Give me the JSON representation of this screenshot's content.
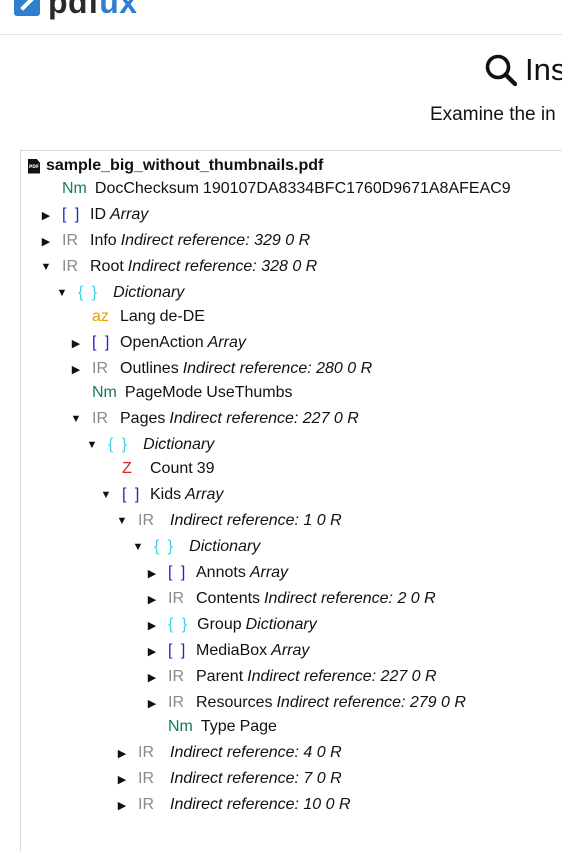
{
  "header": {
    "logo_prefix": "pdf",
    "logo_accent": "ux"
  },
  "page": {
    "title": "Ins",
    "subtitle": "Examine the in"
  },
  "tree": {
    "file_name": "sample_big_without_thumbnails.pdf",
    "rows": [
      {
        "tag": "Nm",
        "key": "DocChecksum",
        "value": "190107DA8334BFC1760D9671A8AFEAC9"
      },
      {
        "tag": "[ ]",
        "key": "ID",
        "value": "Array"
      },
      {
        "tag": "IR",
        "key": "Info",
        "value": "Indirect reference: 329 0 R"
      },
      {
        "tag": "IR",
        "key": "Root",
        "value": "Indirect reference: 328 0 R"
      },
      {
        "tag": "{ }",
        "key": "",
        "value": "Dictionary"
      },
      {
        "tag": "az",
        "key": "Lang",
        "value": "de-DE"
      },
      {
        "tag": "[ ]",
        "key": "OpenAction",
        "value": "Array"
      },
      {
        "tag": "IR",
        "key": "Outlines",
        "value": "Indirect reference: 280 0 R"
      },
      {
        "tag": "Nm",
        "key": "PageMode",
        "value": "UseThumbs"
      },
      {
        "tag": "IR",
        "key": "Pages",
        "value": "Indirect reference: 227 0 R"
      },
      {
        "tag": "{ }",
        "key": "",
        "value": "Dictionary"
      },
      {
        "tag": "Z",
        "key": "Count",
        "value": "39"
      },
      {
        "tag": "[ ]",
        "key": "Kids",
        "value": "Array"
      },
      {
        "tag": "IR",
        "key": "",
        "value": "Indirect reference: 1 0 R"
      },
      {
        "tag": "{ }",
        "key": "",
        "value": "Dictionary"
      },
      {
        "tag": "[ ]",
        "key": "Annots",
        "value": "Array"
      },
      {
        "tag": "IR",
        "key": "Contents",
        "value": "Indirect reference: 2 0 R"
      },
      {
        "tag": "{ }",
        "key": "Group",
        "value": "Dictionary"
      },
      {
        "tag": "[ ]",
        "key": "MediaBox",
        "value": "Array"
      },
      {
        "tag": "IR",
        "key": "Parent",
        "value": "Indirect reference: 227 0 R"
      },
      {
        "tag": "IR",
        "key": "Resources",
        "value": "Indirect reference: 279 0 R"
      },
      {
        "tag": "Nm",
        "key": "Type",
        "value": "Page"
      },
      {
        "tag": "IR",
        "key": "",
        "value": "Indirect reference: 4 0 R"
      },
      {
        "tag": "IR",
        "key": "",
        "value": "Indirect reference: 7 0 R"
      },
      {
        "tag": "IR",
        "key": "",
        "value": "Indirect reference: 10 0 R"
      }
    ]
  },
  "icons": {
    "search": "magnifier-icon",
    "file": "pdf-file-icon",
    "expand": "triangle-right-icon",
    "collapse": "triangle-down-icon"
  },
  "colors": {
    "brand": "#2f7fd0",
    "array": "#2222cc",
    "indirect": "#8a8a8a",
    "dictionary": "#3fd0e6",
    "name": "#1a7a5a",
    "string": "#e8a200",
    "number": "#d92020"
  }
}
